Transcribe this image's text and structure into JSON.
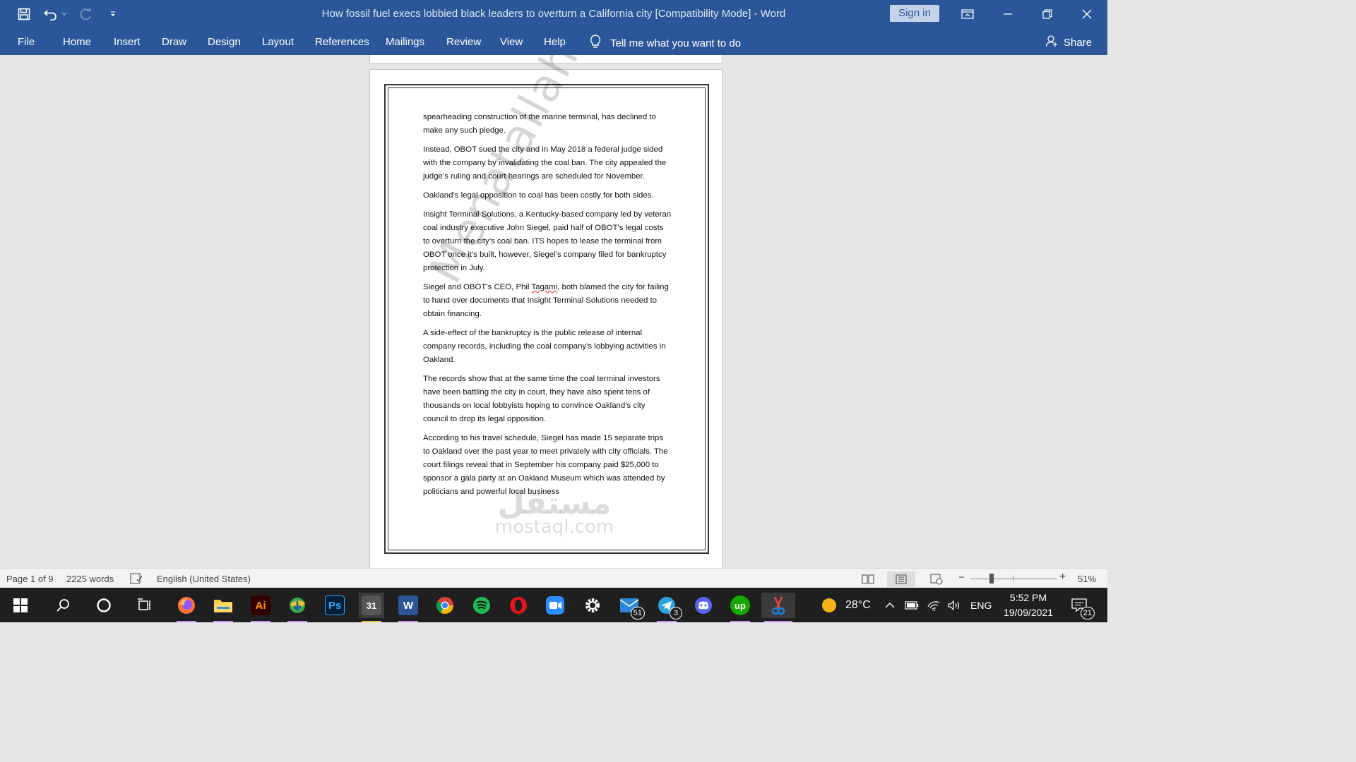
{
  "window": {
    "title": "How fossil fuel execs lobbied black leaders to overturn a California city [Compatibility Mode]  -  Word",
    "sign_in": "Sign in"
  },
  "ribbon": {
    "tabs": [
      "File",
      "Home",
      "Insert",
      "Draw",
      "Design",
      "Layout",
      "References",
      "Mailings",
      "Review",
      "View",
      "Help"
    ],
    "tell_me": "Tell me what you want to do",
    "share": "Share"
  },
  "document": {
    "paragraphs": [
      "spearheading construction of the marine terminal, has declined to make any such pledge.",
      "Instead, OBOT sued the city and in May 2018 a federal judge sided with the company by invalidating the coal ban. The city appealed the judge’s ruling and court hearings are scheduled for November.",
      "Oakland’s legal opposition to coal has been costly for both sides.",
      "Insight Terminal Solutions, a Kentucky-based company led by veteran coal industry executive John Siegel, paid half of OBOT’s legal costs to overturn the city’s coal ban. ITS hopes to lease the terminal from OBOT once it’s built, however, Siegel’s company filed for bankruptcy protection in July.",
      "A side-effect of the bankruptcy is the public release of internal company records, including the coal company’s lobbying activities in Oakland.",
      "The records show that at the same time the coal terminal investors have been battling the city in court, they have also spent tens of thousands on local lobbyists hoping to convince Oakland’s city council to drop its legal opposition.",
      "According to his travel schedule, Siegel has made 15 separate trips to Oakland over the past year to meet privately with city officials. The court filings reveal that in September his company paid $25,000 to sponsor a gala party at an Oakland Museum which was attended by politicians and powerful local business"
    ],
    "p5_before": "Siegel and OBOT’s CEO, Phil ",
    "p5_squiggle": "Tagami",
    "p5_after": ", both blamed the city for failing to hand over documents that Insight Terminal Solutions needed to obtain financing.",
    "watermark": "Menatallah",
    "site_watermark_ar": "مستقل",
    "site_watermark_en": "mostaql.com"
  },
  "status": {
    "page": "Page 1 of 9",
    "words": "2225 words",
    "language": "English (United States)",
    "zoom": "51%",
    "zoom_minus": "−",
    "zoom_plus": "+"
  },
  "taskbar": {
    "temperature": "28°C",
    "lang": "ENG",
    "time": "5:52 PM",
    "date": "19/09/2021",
    "mail_badge": "51",
    "telegram_badge": "3",
    "notif_badge": "21",
    "ai_label": "Ai",
    "ps_label": "Ps",
    "upwork_label": "up",
    "word_label": "W",
    "clip_label": "31"
  },
  "colors": {
    "word_blue": "#2b579a",
    "taskbar": "#1f1f1f",
    "canvas": "#e6e6e6"
  }
}
